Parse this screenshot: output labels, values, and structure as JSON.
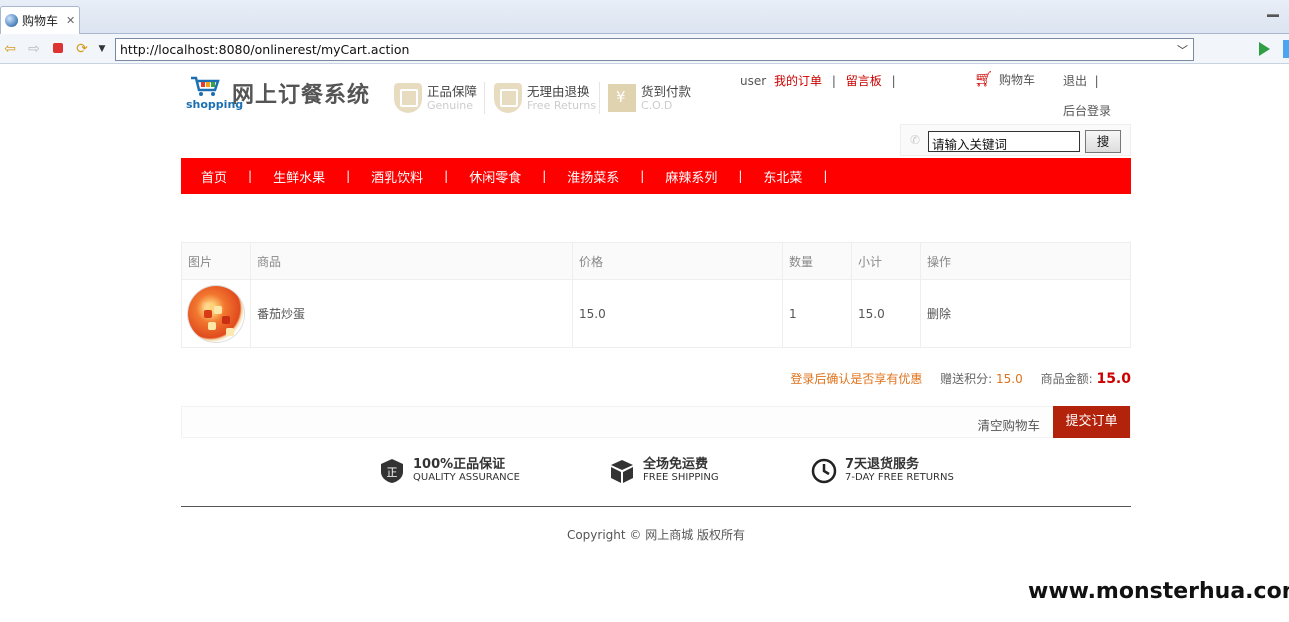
{
  "browser": {
    "tab_title": "购物车",
    "url": "http://localhost:8080/onlinerest/myCart.action"
  },
  "header": {
    "logo_word": "shopping",
    "site_title": "网上订餐系统",
    "badges": [
      {
        "title": "正品保障",
        "subtitle": "Genuine"
      },
      {
        "title": "无理由退换",
        "subtitle": "Free Returns"
      },
      {
        "title": "货到付款",
        "subtitle": "C.O.D"
      }
    ],
    "user": "user",
    "my_orders": "我的订单",
    "guestbook": "留言板",
    "cart": "购物车",
    "logout": "退出",
    "admin_login": "后台登录",
    "search_value": "请输入关键词",
    "search_button": "搜"
  },
  "menu": [
    "首页",
    "生鲜水果",
    "酒乳饮料",
    "休闲零食",
    "淮扬菜系",
    "麻辣系列",
    "东北菜"
  ],
  "cart_table": {
    "headers": [
      "图片",
      "商品",
      "价格",
      "数量",
      "小计",
      "操作"
    ],
    "rows": [
      {
        "name": "番茄炒蛋",
        "price": "15.0",
        "qty": "1",
        "subtotal": "15.0",
        "action": "删除"
      }
    ]
  },
  "summary": {
    "login_hint": "登录后确认是否享有优惠",
    "points_label": "赠送积分:",
    "points_value": "15.0",
    "amount_label": "商品金额:",
    "amount_value": "15.0"
  },
  "actions": {
    "clear_cart": "清空购物车",
    "submit_order": "提交订单"
  },
  "guarantees": [
    {
      "title": "100%正品保证",
      "subtitle": "QUALITY ASSURANCE"
    },
    {
      "title": "全场免运费",
      "subtitle": "FREE SHIPPING"
    },
    {
      "title": "7天退货服务",
      "subtitle": "7-DAY FREE RETURNS"
    }
  ],
  "footer": {
    "copyright": "Copyright © 网上商城 版权所有"
  },
  "watermark": "www.monsterhua.com",
  "colors": {
    "brand_red": "#ff0000",
    "submit_red": "#b3230c",
    "link_red": "#cc0000",
    "accent_orange": "#e0731c"
  }
}
